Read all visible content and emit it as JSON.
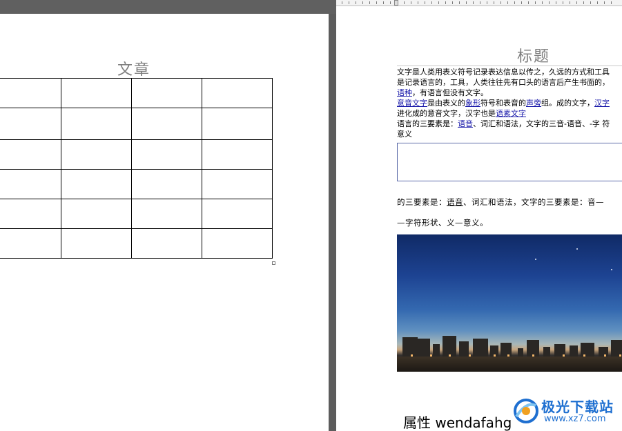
{
  "left_page": {
    "title": "文章",
    "table": {
      "rows": 6,
      "cols": 4
    }
  },
  "right_page": {
    "title": "标题",
    "text_lines": [
      [
        {
          "t": "文字是人类用表义符号记录表达信息以传之，久远的方式和工具"
        }
      ],
      [
        {
          "t": "是记录语言的，工具，人类往往先有口头的语言后产生书面的，"
        }
      ],
      [
        {
          "t": "语种",
          "link": true
        },
        {
          "t": "，有语言但没有文字。"
        }
      ],
      [
        {
          "t": "意音文字",
          "link": true
        },
        {
          "t": "是由表义的"
        },
        {
          "t": "象形",
          "link": true
        },
        {
          "t": "符号和表音的"
        },
        {
          "t": "声旁",
          "link": true
        },
        {
          "t": "组。成的文字，"
        },
        {
          "t": "汉字",
          "link": true
        }
      ],
      [
        {
          "t": "进化成的意音文字，汉字也是"
        },
        {
          "t": "语素文字",
          "link": true
        }
      ],
      [
        {
          "t": "语言的三要素是："
        },
        {
          "t": "语音",
          "link": true
        },
        {
          "t": "、词汇和语法，文字的三音-语音、-字 符"
        }
      ],
      [
        {
          "t": "意义"
        }
      ]
    ],
    "para1": [
      {
        "t": "的三要素是："
      },
      {
        "t": "语音",
        "ul": true
      },
      {
        "t": "、词汇和语法，文字的三要素是：音—"
      }
    ],
    "para2": "—字符形状、义—意义。",
    "bottom_heading": "属性 wendafahg"
  },
  "watermark": {
    "name": "极光下载站",
    "url": "www.xz7.com"
  },
  "colors": {
    "link": "#1a1aaa",
    "title_gray": "#7f7f7f",
    "watermark_blue": "#1e6fd0",
    "textbox_border": "#5a69a8"
  }
}
